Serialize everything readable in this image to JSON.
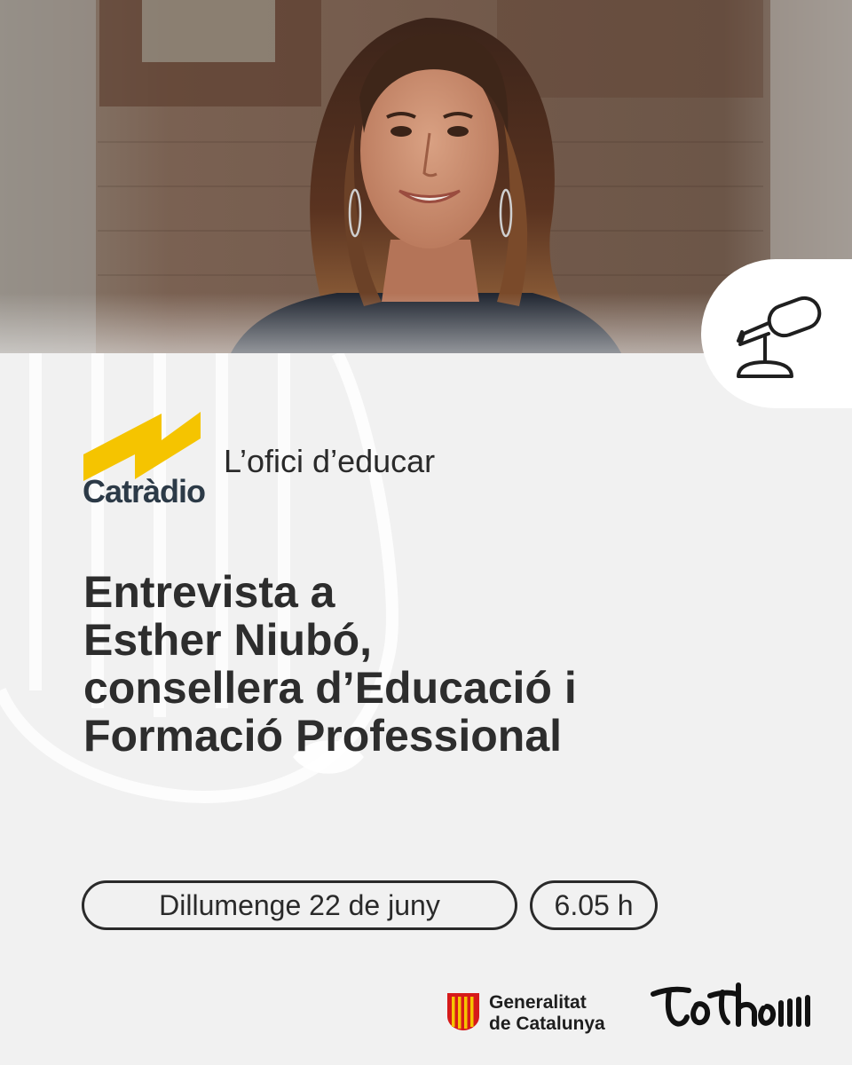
{
  "photo": {
    "icon": "portrait-photo"
  },
  "badge": {
    "icon": "microphone-icon"
  },
  "program": {
    "brand": "Catràdio",
    "name": "L’ofici d’educar"
  },
  "headline": {
    "lines": [
      "Entrevista a",
      "Esther Niubó,",
      "consellera d’Educació i",
      "Formació Professional"
    ]
  },
  "schedule": {
    "date": "Dillumenge 22 de juny",
    "time": "6.05 h"
  },
  "footer": {
    "gencat_lines": [
      "Generalitat",
      "de Catalunya"
    ],
    "tothom": "tothom"
  },
  "colors": {
    "background": "#f1f1f1",
    "text": "#2d2d2d",
    "catradio_yellow": "#f5c400",
    "catradio_navy": "#2c3a47",
    "gencat_red": "#d61a1a"
  }
}
